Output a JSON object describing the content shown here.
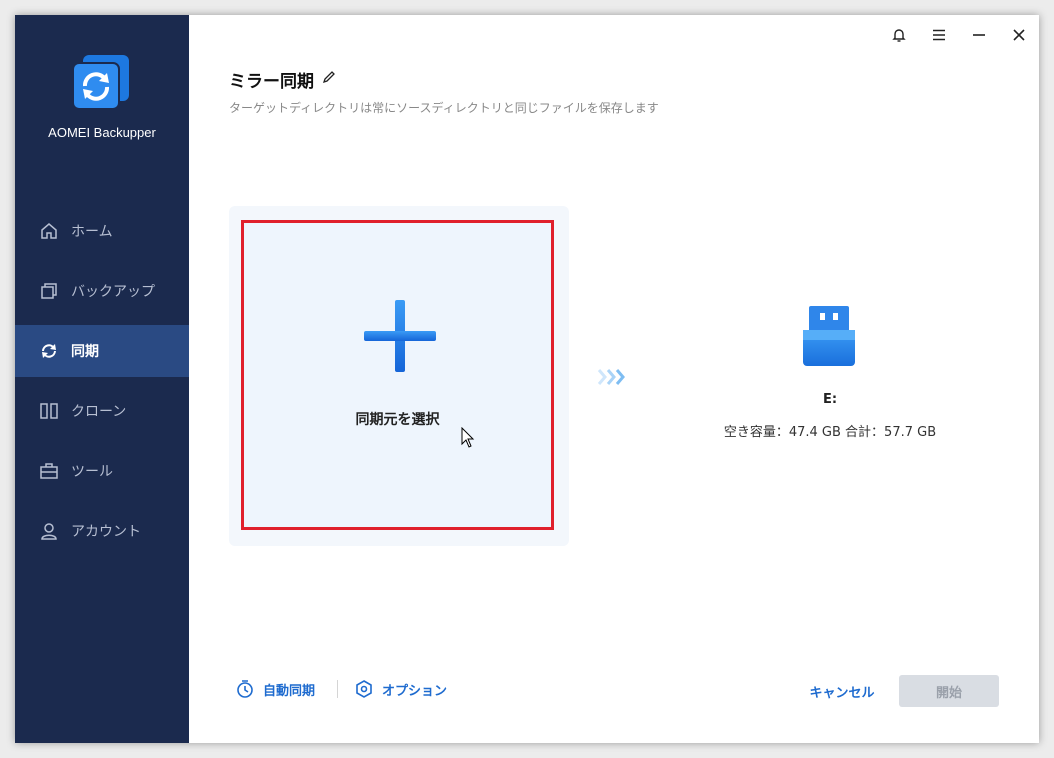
{
  "app": {
    "name": "AOMEI Backupper"
  },
  "sidebar": {
    "items": [
      {
        "label": "ホーム",
        "icon": "home-icon",
        "active": false
      },
      {
        "label": "バックアップ",
        "icon": "backup-icon",
        "active": false
      },
      {
        "label": "同期",
        "icon": "sync-icon",
        "active": true
      },
      {
        "label": "クローン",
        "icon": "clone-icon",
        "active": false
      },
      {
        "label": "ツール",
        "icon": "toolbox-icon",
        "active": false
      },
      {
        "label": "アカウント",
        "icon": "user-icon",
        "active": false
      }
    ]
  },
  "titlebar": {
    "icons": [
      "bell-icon",
      "menu-icon",
      "minimize-icon",
      "close-icon"
    ]
  },
  "header": {
    "title": "ミラー同期",
    "subtitle": "ターゲットディレクトリは常にソースディレクトリと同じファイルを保存します"
  },
  "source": {
    "label": "同期元を選択"
  },
  "destination": {
    "drive": "E:",
    "capacity": "空き容量：47.4 GB 合計：57.7 GB"
  },
  "footer": {
    "auto_sync": "自動同期",
    "options": "オプション",
    "cancel": "キャンセル",
    "start": "開始"
  },
  "colors": {
    "sidebar_bg": "#1b2a4e",
    "active_item": "#2a4a83",
    "accent": "#1e6bcf",
    "highlight_border": "#e0202c"
  }
}
